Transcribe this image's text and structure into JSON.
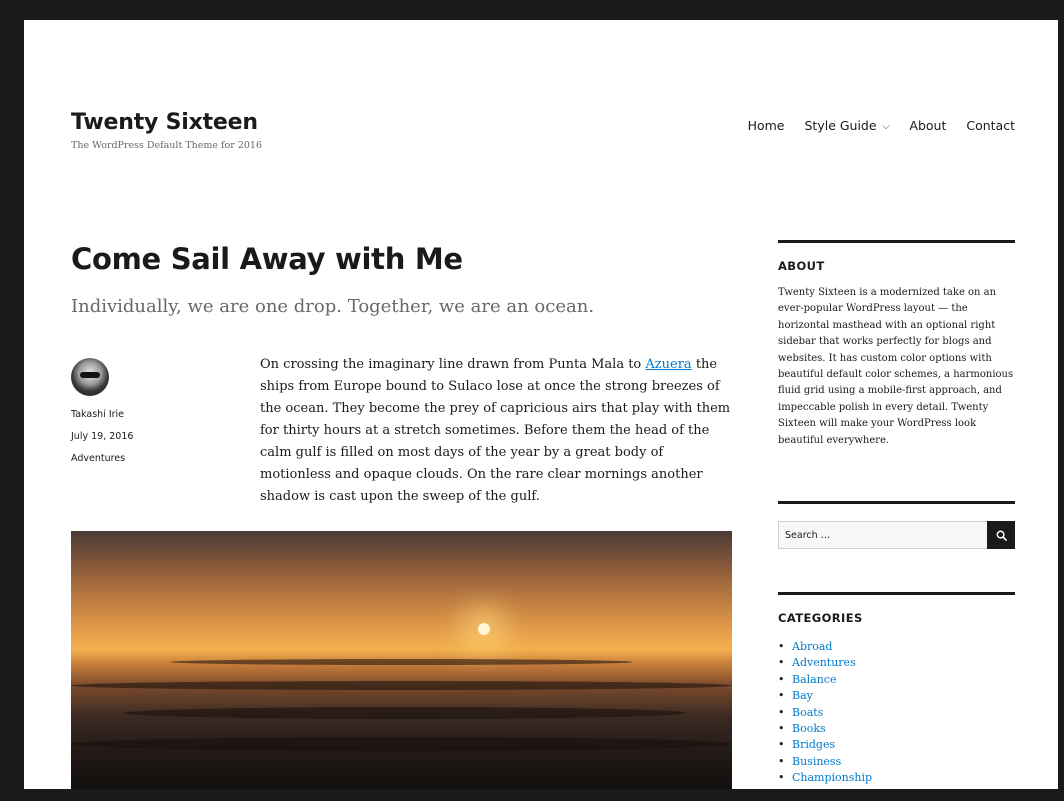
{
  "site": {
    "title": "Twenty Sixteen",
    "description": "The WordPress Default Theme for 2016"
  },
  "nav": {
    "items": [
      {
        "label": "Home"
      },
      {
        "label": "Style Guide"
      },
      {
        "label": "About"
      },
      {
        "label": "Contact"
      }
    ],
    "dropdown_icon": "chevron-down-icon"
  },
  "post": {
    "title": "Come Sail Away with Me",
    "excerpt": "Individually, we are one drop. Together, we are an ocean.",
    "author": "Takashi Irie",
    "date": "July 19, 2016",
    "category": "Adventures",
    "body_before_link": "On crossing the imaginary line drawn from Punta Mala to ",
    "link_text": "Azuera",
    "body_after_link": " the ships from Europe bound to Sulaco lose at once the strong breezes of the ocean. They become the prey of capricious airs that play with them for thirty hours at a stretch sometimes. Before them the head of the calm gulf is filled on most days of the year by a great body of motionless and opaque clouds. On the rare clear mornings another shadow is cast upon the sweep of the gulf."
  },
  "sidebar": {
    "about": {
      "title": "ABOUT",
      "text": "Twenty Sixteen is a modernized take on an ever-popular WordPress layout — the horizontal masthead with an optional right sidebar that works perfectly for blogs and websites. It has custom color options with beautiful default color schemes, a harmonious fluid grid using a mobile-first approach, and impeccable polish in every detail. Twenty Sixteen will make your WordPress look beautiful everywhere."
    },
    "search": {
      "placeholder": "Search …",
      "button_icon": "search-icon"
    },
    "categories": {
      "title": "CATEGORIES",
      "items": [
        "Abroad",
        "Adventures",
        "Balance",
        "Bay",
        "Boats",
        "Books",
        "Bridges",
        "Business",
        "Championship"
      ]
    }
  },
  "colors": {
    "link": "#007acc",
    "text": "#1a1a1a",
    "muted": "#686868",
    "frame": "#1a1a1a"
  }
}
